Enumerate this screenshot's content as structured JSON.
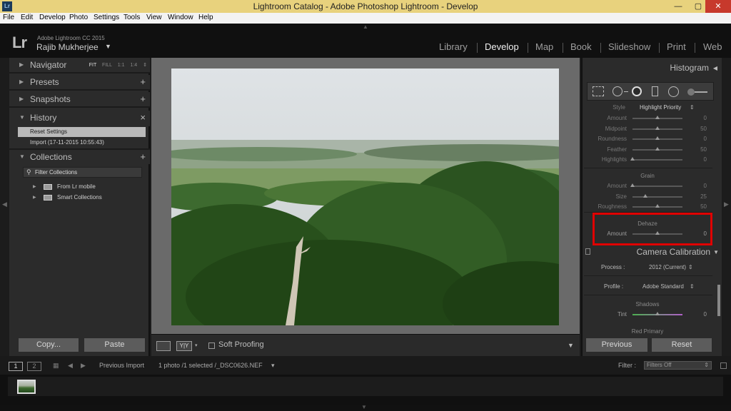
{
  "window": {
    "title": "Lightroom Catalog - Adobe Photoshop Lightroom - Develop",
    "app_icon": "Lr",
    "minimize": "—",
    "maximize": "▢",
    "close": "✕"
  },
  "menu": [
    "File",
    "Edit",
    "Develop",
    "Photo",
    "Settings",
    "Tools",
    "View",
    "Window",
    "Help"
  ],
  "identity": {
    "logo": "Lr",
    "version": "Adobe Lightroom CC 2015",
    "user": "Rajib Mukherjee",
    "caret": "▼"
  },
  "modules": [
    "Library",
    "Develop",
    "Map",
    "Book",
    "Slideshow",
    "Print",
    "Web"
  ],
  "active_module": "Develop",
  "left_panel": {
    "navigator": {
      "label": "Navigator",
      "modes": [
        "FIT",
        "FILL",
        "1:1",
        "1:4"
      ],
      "active_mode": "FIT"
    },
    "presets": {
      "label": "Presets",
      "action": "+"
    },
    "snapshots": {
      "label": "Snapshots",
      "action": "+"
    },
    "history": {
      "label": "History",
      "action": "×",
      "items": [
        "Reset Settings",
        "Import (17-11-2015 10:55:43)"
      ]
    },
    "collections": {
      "label": "Collections",
      "action": "+",
      "filter_placeholder": "Filter Collections",
      "items": [
        "From Lr mobile",
        "Smart Collections"
      ]
    },
    "buttons": {
      "copy": "Copy...",
      "paste": "Paste"
    }
  },
  "toolbar": {
    "soft_proofing": "Soft Proofing"
  },
  "right_panel": {
    "histogram_label": "Histogram",
    "vignette": {
      "style_label": "Style",
      "style_value": "Highlight Priority",
      "rows": [
        {
          "label": "Amount",
          "value": "0",
          "pos": 0.5
        },
        {
          "label": "Midpoint",
          "value": "50",
          "pos": 0.5
        },
        {
          "label": "Roundness",
          "value": "0",
          "pos": 0.5
        },
        {
          "label": "Feather",
          "value": "50",
          "pos": 0.5
        },
        {
          "label": "Highlights",
          "value": "0",
          "pos": 0.0
        }
      ]
    },
    "grain": {
      "title": "Grain",
      "rows": [
        {
          "label": "Amount",
          "value": "0",
          "pos": 0.0
        },
        {
          "label": "Size",
          "value": "25",
          "pos": 0.25
        },
        {
          "label": "Roughness",
          "value": "50",
          "pos": 0.5
        }
      ]
    },
    "dehaze": {
      "title": "Dehaze",
      "rows": [
        {
          "label": "Amount",
          "value": "0",
          "pos": 0.5
        }
      ]
    },
    "camera_calibration": {
      "title": "Camera Calibration",
      "process_label": "Process :",
      "process_value": "2012 (Current)",
      "profile_label": "Profile :",
      "profile_value": "Adobe Standard",
      "shadows_title": "Shadows",
      "tint_label": "Tint",
      "tint_value": "0",
      "red_primary": "Red Primary"
    },
    "buttons": {
      "previous": "Previous",
      "reset": "Reset"
    }
  },
  "filmstrip": {
    "screen1": "1",
    "screen2": "2",
    "source": "Previous Import",
    "info": "1 photo /1 selected /_DSC0626.NEF",
    "filter_label": "Filter :",
    "filter_value": "Filters Off"
  },
  "colors": {
    "titlebar": "#e8d27d",
    "highlight_box": "#e00000",
    "panel_bg": "#2b2b2b"
  }
}
